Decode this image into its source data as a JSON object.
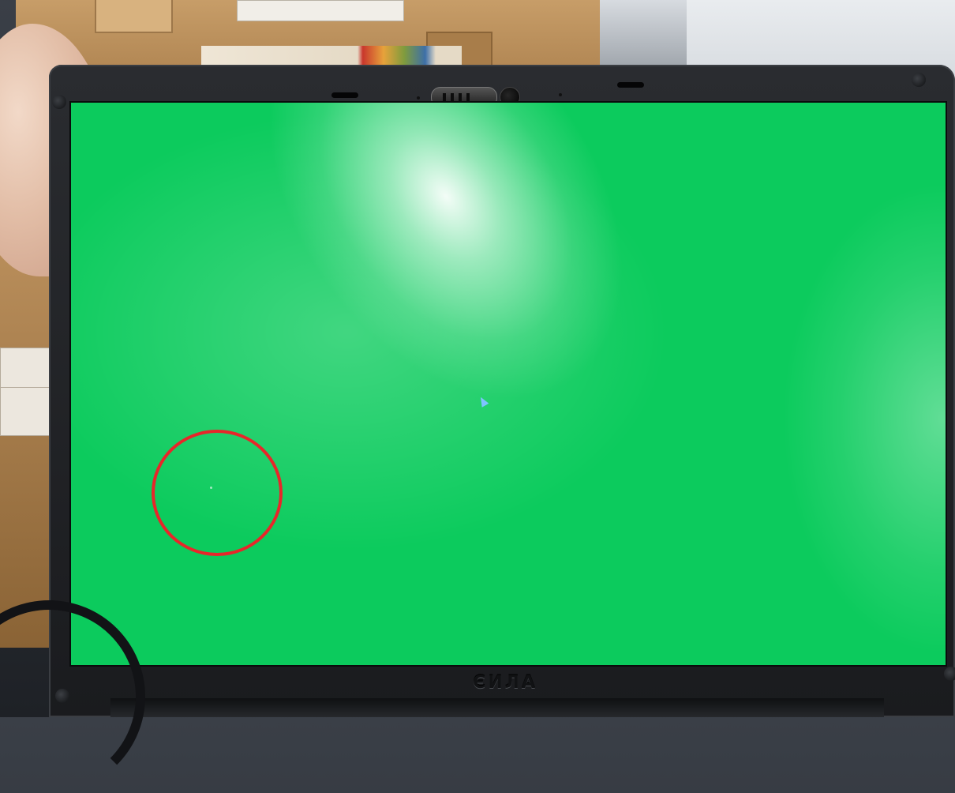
{
  "laptop": {
    "brand_text": "ЄИЛА",
    "screen_color": "#0ccb5d",
    "bezel_color": "#1c1d20"
  },
  "annotation": {
    "marker_color": "#e8262a",
    "marker_shape": "circle"
  },
  "icons": {
    "cursor": "mouse-cursor-icon",
    "webcam": "webcam-icon",
    "shutter": "webcam-shutter-icon"
  }
}
